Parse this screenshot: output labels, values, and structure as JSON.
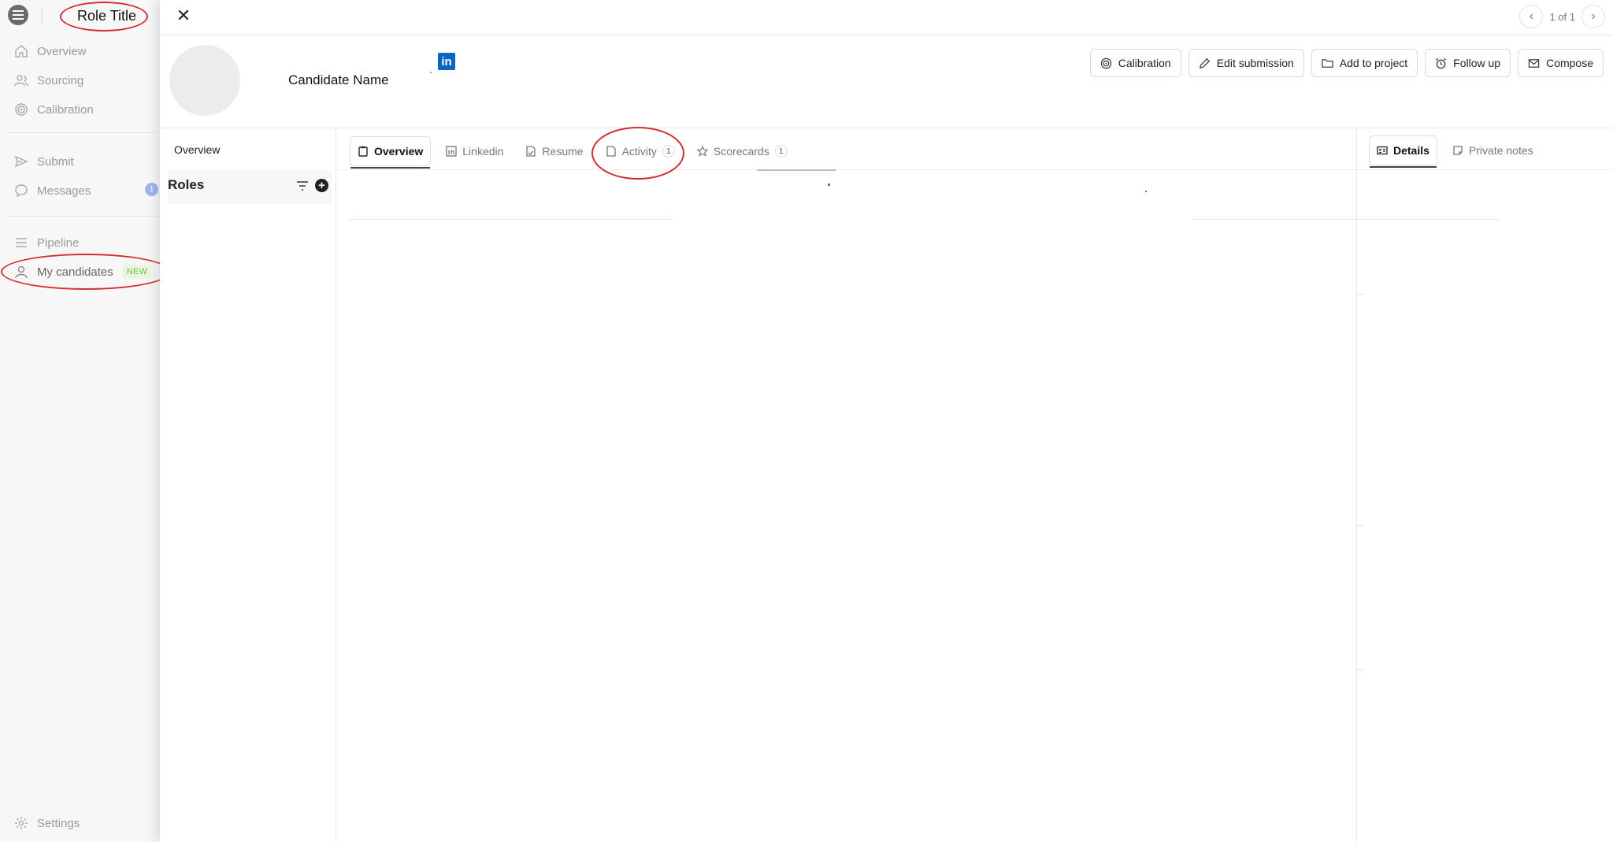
{
  "topbar": {
    "role_title": "Role Title"
  },
  "sidebar": {
    "items": [
      {
        "label": "Overview",
        "icon": "home-icon"
      },
      {
        "label": "Sourcing",
        "icon": "people-icon"
      },
      {
        "label": "Calibration",
        "icon": "target-icon"
      },
      {
        "label": "Submit",
        "icon": "send-icon"
      },
      {
        "label": "Messages",
        "icon": "chat-icon",
        "badge": "1"
      },
      {
        "label": "Pipeline",
        "icon": "list-icon"
      },
      {
        "label": "My candidates",
        "icon": "person-icon",
        "tag": "NEW"
      },
      {
        "label": "Settings",
        "icon": "gear-icon"
      }
    ]
  },
  "panel": {
    "pager": {
      "text": "1 of 1"
    },
    "candidate": {
      "name": "Candidate Name",
      "separator": "."
    },
    "actions": [
      {
        "label": "Calibration",
        "icon": "target-icon"
      },
      {
        "label": "Edit submission",
        "icon": "pencil-icon"
      },
      {
        "label": "Add to project",
        "icon": "folder-icon"
      },
      {
        "label": "Follow up",
        "icon": "alarm-icon"
      },
      {
        "label": "Compose",
        "icon": "mail-icon"
      }
    ],
    "left": {
      "overview": "Overview",
      "roles_title": "Roles"
    },
    "tabs": [
      {
        "label": "Overview",
        "icon": "clipboard-icon",
        "active": true
      },
      {
        "label": "Linkedin",
        "icon": "linkedin-icon"
      },
      {
        "label": "Resume",
        "icon": "resume-icon"
      },
      {
        "label": "Activity",
        "icon": "file-icon",
        "count": "1"
      },
      {
        "label": "Scorecards",
        "icon": "star-icon",
        "count": "1"
      }
    ],
    "right_tabs": [
      {
        "label": "Details",
        "icon": "id-card-icon",
        "active": true
      },
      {
        "label": "Private notes",
        "icon": "note-icon"
      }
    ]
  },
  "colors": {
    "annotation": "#d32f2f",
    "linkedin": "#0a66c2",
    "new_badge": "#7ac150",
    "message_badge": "#9db6ee"
  }
}
